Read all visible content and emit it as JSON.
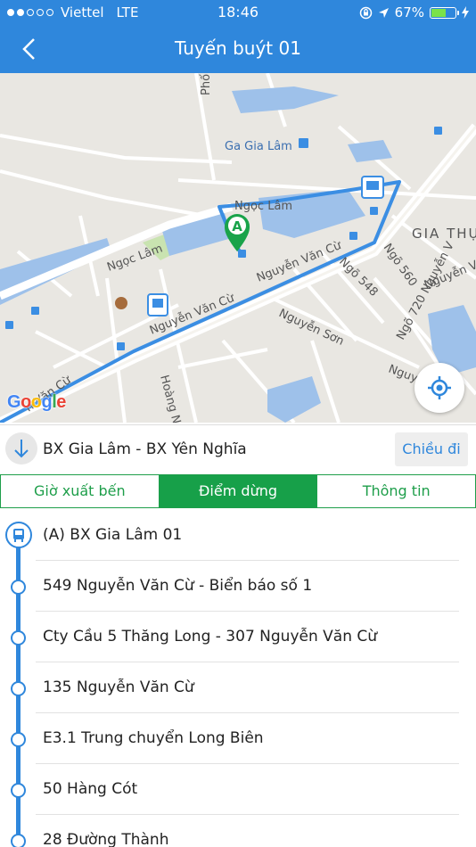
{
  "status_bar": {
    "carrier": "Viettel",
    "network": "LTE",
    "time": "18:46",
    "battery": "67%",
    "battery_level": 0.67
  },
  "header": {
    "title": "Tuyến buýt 01"
  },
  "map": {
    "labels": {
      "pho": "Phố",
      "ga_gia_lam": "Ga Gia Lâm",
      "ngoc_lam_top": "Ngọc Lâm",
      "ngoc_lam_left": "Ngọc Lâm",
      "gia_thuy": "GIA THỤ",
      "nvc_1": "Nguyễn Văn Cừ",
      "nvc_2": "Nguyễn Văn Cừ",
      "nvc_3": "Nguyễn Văn Cừ",
      "nvc_4": "n Văn Cừ",
      "ngo_560": "Ngõ 560",
      "ngo_548": "Ngõ 548",
      "ngo_720": "Ngõ 720 Nguyễn V",
      "nguyen_son": "Nguyễn Sơn",
      "nguyen_partial": "Nguyễ",
      "hoang": "Hoàng N",
      "marker": "A"
    },
    "google_logo": "Google"
  },
  "route": {
    "name": "BX Gia Lâm - BX Yên Nghĩa",
    "direction_button": "Chiều đi"
  },
  "tabs": [
    {
      "label": "Giờ xuất bến",
      "active": false
    },
    {
      "label": "Điểm dừng",
      "active": true
    },
    {
      "label": "Thông tin",
      "active": false
    }
  ],
  "stops": [
    "(A) BX Gia Lâm 01",
    "549 Nguyễn Văn Cừ - Biển báo số 1",
    "Cty Cầu 5 Thăng Long - 307 Nguyễn Văn Cừ",
    "135 Nguyễn Văn Cừ",
    "E3.1 Trung chuyển Long Biên",
    "50 Hàng Cót",
    "28 Đường Thành"
  ],
  "colors": {
    "primary": "#2f87dc",
    "tab_green": "#17a049",
    "marker_green": "#19a34a"
  }
}
